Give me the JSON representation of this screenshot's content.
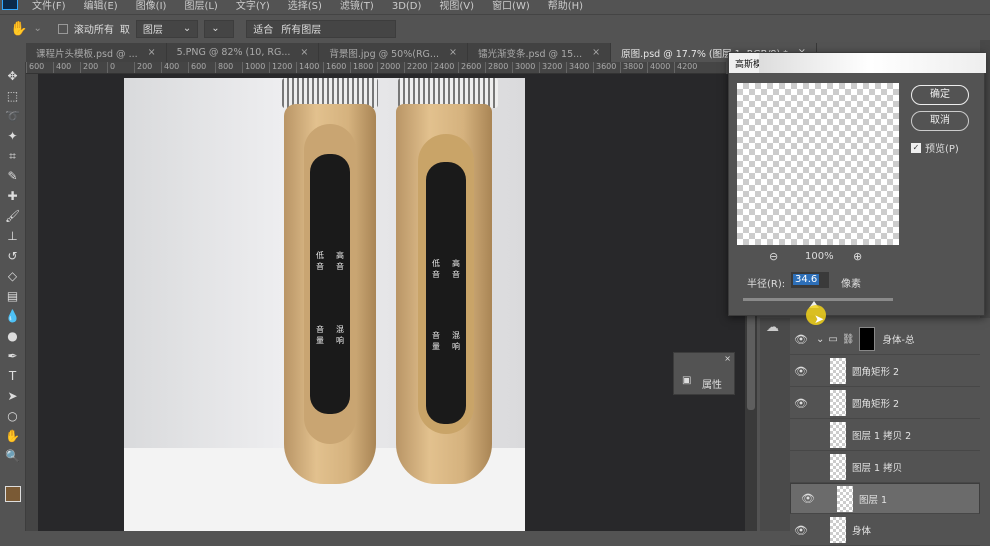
{
  "menu": [
    "文件(F)",
    "编辑(E)",
    "图像(I)",
    "图层(L)",
    "文字(Y)",
    "选择(S)",
    "滤镜(T)",
    "3D(D)",
    "视图(V)",
    "窗口(W)",
    "帮助(H)"
  ],
  "options": {
    "scroll_all": "滚动所有",
    "take": "取",
    "layer_sel": "图层",
    "fit": "适合",
    "all_layers": "所有图层"
  },
  "tabs": [
    {
      "label": "课程片头模板.psd @ ...",
      "close": "×"
    },
    {
      "label": "5.PNG @ 82% (10, RG...",
      "close": "×"
    },
    {
      "label": "背景图.jpg @ 50%(RG...",
      "close": "×"
    },
    {
      "label": "镭光渐变条.psd @ 15...",
      "close": "×"
    },
    {
      "label": "原图.psd @ 17.7% (图层 1, RGB/8) *",
      "close": "×"
    }
  ],
  "ruler": [
    "600",
    "400",
    "200",
    "0",
    "200",
    "400",
    "600",
    "800",
    "1000",
    "1200",
    "1400",
    "1600",
    "1800",
    "2000",
    "2200",
    "2400",
    "2600",
    "2800",
    "3000",
    "3200",
    "3400",
    "3600",
    "3800",
    "4000",
    "4200"
  ],
  "product": {
    "low": "低音",
    "high": "高音",
    "volume": "音量",
    "reverb": "混响"
  },
  "dialog": {
    "title": "高斯模糊",
    "ok": "确定",
    "cancel": "取消",
    "preview": "预览(P)",
    "zoom": "100%",
    "radius_label": "半径(R):",
    "radius_value": "34.6",
    "unit": "像素",
    "radius_slider": 0.47
  },
  "properties": {
    "label": "属性"
  },
  "layers": [
    {
      "name": "身体-总",
      "visible": true,
      "group": true
    },
    {
      "name": "圆角矩形 2",
      "visible": true
    },
    {
      "name": "圆角矩形 2",
      "visible": true
    },
    {
      "name": "图层 1 拷贝 2",
      "visible": false
    },
    {
      "name": "图层 1 拷贝",
      "visible": false
    },
    {
      "name": "图层 1",
      "visible": true,
      "selected": true
    },
    {
      "name": "身体",
      "visible": true
    }
  ]
}
